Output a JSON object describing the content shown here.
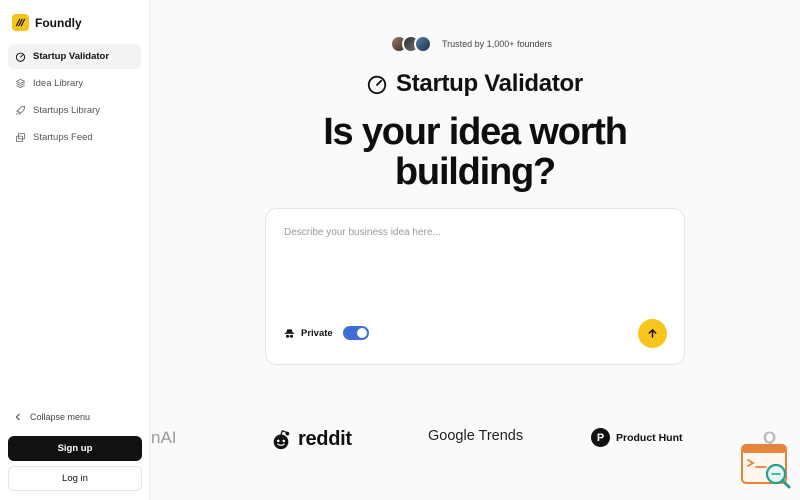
{
  "brand": {
    "name": "Foundly"
  },
  "sidebar": {
    "items": [
      {
        "label": "Startup Validator",
        "icon": "gauge-icon",
        "active": true
      },
      {
        "label": "Idea Library",
        "icon": "layers-icon",
        "active": false
      },
      {
        "label": "Startups Library",
        "icon": "rocket-icon",
        "active": false
      },
      {
        "label": "Startups Feed",
        "icon": "feed-icon",
        "active": false
      }
    ],
    "collapse_label": "Collapse menu",
    "signup_label": "Sign up",
    "login_label": "Log in"
  },
  "main": {
    "trusted_text": "Trusted by 1,000+ founders",
    "product_title": "Startup Validator",
    "headline_line1": "Is your idea worth",
    "headline_line2": "building?",
    "input_placeholder": "Describe your business idea here...",
    "private_label": "Private",
    "private_on": true
  },
  "logos": {
    "openai": "nAI",
    "reddit": "reddit",
    "google_trends": "Google Trends",
    "product_hunt_mark": "P",
    "product_hunt": "Product Hunt",
    "partial": "Q"
  },
  "colors": {
    "accent_yellow": "#f7c51c",
    "toggle_blue": "#3e6fd6",
    "dark": "#111111"
  }
}
